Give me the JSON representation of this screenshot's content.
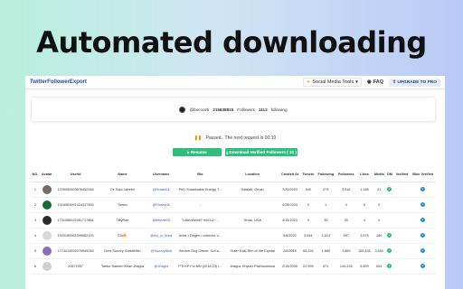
{
  "headline": "Automated downloading",
  "app": {
    "title": "TwitterFollowerExport",
    "nav_tools": "Social Media Tools",
    "faq": "FAQ",
    "upgrade": "UPGRADE TO PRO"
  },
  "profile": {
    "handle": "@bocoozk",
    "followers_count": "215638815",
    "followers_label": "Followers",
    "following_count": "1112",
    "following_label": "following"
  },
  "status": {
    "text": "Paused.. The next request in 00:10"
  },
  "buttons": {
    "resume": "Resume",
    "download": "Download Verified Followers (  32 )"
  },
  "table": {
    "headers": [
      "NO.",
      "Avatar",
      "UserId",
      "Name",
      "Username",
      "Bio",
      "Location",
      "Created At",
      "Tweets",
      "Following",
      "Followers",
      "Likes",
      "Media",
      "DM",
      "Verified",
      "Blue Verified"
    ],
    "rows": [
      {
        "no": "1",
        "userid": "1205050503676452248",
        "name": "Dr. Said Jabeen",
        "username": "@Drsaid01",
        "bio": "PhD Sustainable Energy T...",
        "location": "Salalah, Oman",
        "created": "7/20/2023",
        "tweets": "940",
        "following": "274",
        "followers": "3,516",
        "likes": "1,185",
        "media": "21",
        "dm": "g",
        "verified": "",
        "blue": "b",
        "avatar": "#7a6a5a"
      },
      {
        "no": "2",
        "userid": "1316063691424317455",
        "name": "Tiesev",
        "username": "@Tiesev06",
        "bio": "-",
        "location": "",
        "created": "4/29/2023",
        "tweets": "0",
        "following": "1",
        "followers": "0",
        "likes": "0",
        "media": "0",
        "dm": "",
        "verified": "",
        "blue": "b",
        "avatar": "#1a6b3a"
      },
      {
        "no": "3",
        "userid": "1701066022451717884",
        "name": "TiffyRae",
        "username": "@tiffyrae09",
        "bio": "\"Little•Well•R~wh\\1•2~...",
        "location": "Texas, USA",
        "created": "4/15/2023",
        "tweets": "9",
        "following": "35",
        "followers": "30",
        "likes": "4",
        "media": "0",
        "dm": "",
        "verified": "",
        "blue": "b",
        "avatar": "#2c2c2c"
      },
      {
        "no": "4",
        "userid": "1520180064349682193",
        "name": "Elo🔥",
        "username": "@elo_is_fixed",
        "bio": "Artist • Degen • collector o...",
        "location": "",
        "created": "5/8/2022",
        "tweets": "3,544",
        "following": "1,013",
        "followers": "597",
        "likes": "3,576",
        "media": "186",
        "dm": "g",
        "verified": "",
        "blue": "b",
        "avatar": "#d8d8d8"
      },
      {
        "no": "5",
        "userid": "1774414926376949248",
        "name": "Dres Suzzzy Cuddlefish",
        "username": "@Suzzzyfiedl",
        "bio": "Service Dog Owner. Got a...",
        "location": "Outer East Rim of the Crystal",
        "created": "2/6/2019",
        "tweets": "65,226",
        "following": "1,689",
        "followers": "1,669",
        "likes": "155,430",
        "media": "3,590",
        "dm": "g",
        "verified": "",
        "blue": "b",
        "avatar": "#8a6fb3"
      },
      {
        "no": "6",
        "userid": "20671957",
        "name": "Tamur Saleem Khan Jhagra",
        "username": "@Jhagra",
        "bio": "PTI KP Fin MN (2018-23) l...",
        "location": "Jhagra, Khyber Pakhtunkhwa",
        "created": "2/15/2009",
        "tweets": "22,995",
        "following": "671",
        "followers": "144,228",
        "likes": "8,609",
        "media": "654",
        "dm": "g",
        "verified": "",
        "blue": "b",
        "avatar": "#cfcfcf"
      }
    ]
  },
  "colors": {
    "accent": "#2fbe7b",
    "link": "#2a5bd7",
    "brand": "#1f4aa8"
  }
}
